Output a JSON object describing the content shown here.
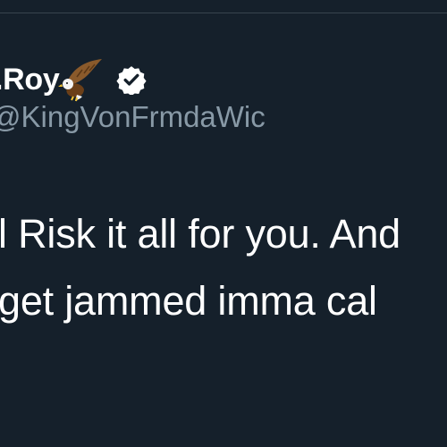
{
  "tweet": {
    "author": {
      "display_name": ".Roy",
      "handle": "@KingVonFrmdaWic",
      "name_emoji_icon": "eagle-icon",
      "verified_icon": "verified-badge-icon"
    },
    "text_lines": [
      "l Risk it all for you. And",
      "get jammed imma cal"
    ]
  },
  "colors": {
    "background": "#15202b",
    "divider": "#38444d",
    "primary_text": "#ffffff",
    "secondary_text": "#8899a6"
  }
}
